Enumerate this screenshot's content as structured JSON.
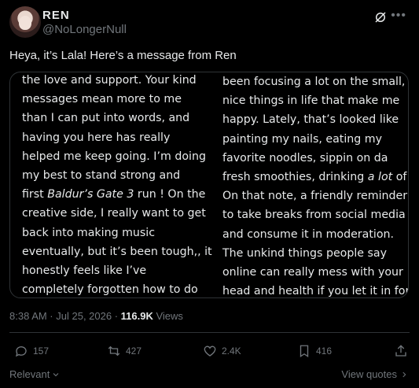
{
  "author": {
    "name": "REN",
    "handle": "@NoLongerNull"
  },
  "tweet": {
    "text": "Heya, it’s Lala! Here’s a message from Ren",
    "image": {
      "left_lines": [
        "the love and support. Your kind",
        "messages mean more to me",
        "than I can put into words, and",
        "having you here has really",
        "helped me keep going. I’m doing",
        "my best to stand strong and",
        "first ",
        "creative side, I really want to get",
        "back into making music",
        "eventually, but it’s been tough,, it",
        "honestly feels like I’ve",
        "completely forgotten how to do"
      ],
      "left_italic_game": "Baldur’s Gate 3",
      "left_after_game": " run ! On the",
      "right_lines": [
        "been focusing a lot on the small,",
        "nice things in life that make me",
        "happy. Lately, that’s looked like",
        "painting my nails, eating my",
        "favorite noodles, sippin on da",
        "fresh smoothies, drinking ",
        "On that note, a friendly reminder",
        "to take breaks from social media",
        "and consume it in moderation.",
        "The unkind things people say",
        "online can really mess with your",
        "head and health if you let it in for"
      ],
      "right_italic": "a lot",
      "right_after_italic": " of"
    },
    "timestamp": "8:38 AM · Jul 25, 2026",
    "separator": " · ",
    "views_count": "116.9K",
    "views_label": " Views"
  },
  "actions": {
    "replies": "157",
    "reposts": "427",
    "likes": "2.4K",
    "bookmarks": "416"
  },
  "footer": {
    "sort_label": "Relevant",
    "view_quotes": "View quotes"
  }
}
